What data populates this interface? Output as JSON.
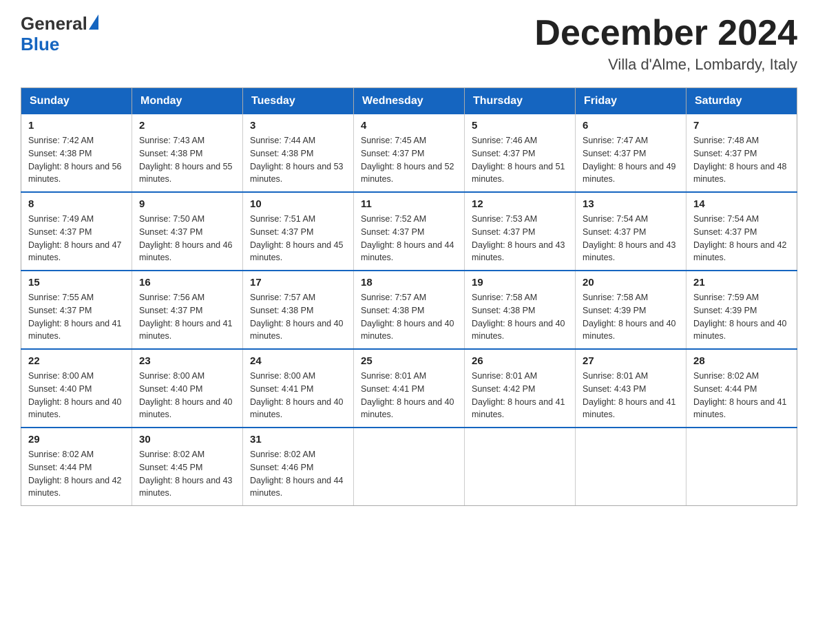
{
  "logo": {
    "general": "General",
    "blue": "Blue"
  },
  "title": "December 2024",
  "subtitle": "Villa d'Alme, Lombardy, Italy",
  "days_header": [
    "Sunday",
    "Monday",
    "Tuesday",
    "Wednesday",
    "Thursday",
    "Friday",
    "Saturday"
  ],
  "weeks": [
    [
      {
        "day": "1",
        "sunrise": "7:42 AM",
        "sunset": "4:38 PM",
        "daylight": "8 hours and 56 minutes."
      },
      {
        "day": "2",
        "sunrise": "7:43 AM",
        "sunset": "4:38 PM",
        "daylight": "8 hours and 55 minutes."
      },
      {
        "day": "3",
        "sunrise": "7:44 AM",
        "sunset": "4:38 PM",
        "daylight": "8 hours and 53 minutes."
      },
      {
        "day": "4",
        "sunrise": "7:45 AM",
        "sunset": "4:37 PM",
        "daylight": "8 hours and 52 minutes."
      },
      {
        "day": "5",
        "sunrise": "7:46 AM",
        "sunset": "4:37 PM",
        "daylight": "8 hours and 51 minutes."
      },
      {
        "day": "6",
        "sunrise": "7:47 AM",
        "sunset": "4:37 PM",
        "daylight": "8 hours and 49 minutes."
      },
      {
        "day": "7",
        "sunrise": "7:48 AM",
        "sunset": "4:37 PM",
        "daylight": "8 hours and 48 minutes."
      }
    ],
    [
      {
        "day": "8",
        "sunrise": "7:49 AM",
        "sunset": "4:37 PM",
        "daylight": "8 hours and 47 minutes."
      },
      {
        "day": "9",
        "sunrise": "7:50 AM",
        "sunset": "4:37 PM",
        "daylight": "8 hours and 46 minutes."
      },
      {
        "day": "10",
        "sunrise": "7:51 AM",
        "sunset": "4:37 PM",
        "daylight": "8 hours and 45 minutes."
      },
      {
        "day": "11",
        "sunrise": "7:52 AM",
        "sunset": "4:37 PM",
        "daylight": "8 hours and 44 minutes."
      },
      {
        "day": "12",
        "sunrise": "7:53 AM",
        "sunset": "4:37 PM",
        "daylight": "8 hours and 43 minutes."
      },
      {
        "day": "13",
        "sunrise": "7:54 AM",
        "sunset": "4:37 PM",
        "daylight": "8 hours and 43 minutes."
      },
      {
        "day": "14",
        "sunrise": "7:54 AM",
        "sunset": "4:37 PM",
        "daylight": "8 hours and 42 minutes."
      }
    ],
    [
      {
        "day": "15",
        "sunrise": "7:55 AM",
        "sunset": "4:37 PM",
        "daylight": "8 hours and 41 minutes."
      },
      {
        "day": "16",
        "sunrise": "7:56 AM",
        "sunset": "4:37 PM",
        "daylight": "8 hours and 41 minutes."
      },
      {
        "day": "17",
        "sunrise": "7:57 AM",
        "sunset": "4:38 PM",
        "daylight": "8 hours and 40 minutes."
      },
      {
        "day": "18",
        "sunrise": "7:57 AM",
        "sunset": "4:38 PM",
        "daylight": "8 hours and 40 minutes."
      },
      {
        "day": "19",
        "sunrise": "7:58 AM",
        "sunset": "4:38 PM",
        "daylight": "8 hours and 40 minutes."
      },
      {
        "day": "20",
        "sunrise": "7:58 AM",
        "sunset": "4:39 PM",
        "daylight": "8 hours and 40 minutes."
      },
      {
        "day": "21",
        "sunrise": "7:59 AM",
        "sunset": "4:39 PM",
        "daylight": "8 hours and 40 minutes."
      }
    ],
    [
      {
        "day": "22",
        "sunrise": "8:00 AM",
        "sunset": "4:40 PM",
        "daylight": "8 hours and 40 minutes."
      },
      {
        "day": "23",
        "sunrise": "8:00 AM",
        "sunset": "4:40 PM",
        "daylight": "8 hours and 40 minutes."
      },
      {
        "day": "24",
        "sunrise": "8:00 AM",
        "sunset": "4:41 PM",
        "daylight": "8 hours and 40 minutes."
      },
      {
        "day": "25",
        "sunrise": "8:01 AM",
        "sunset": "4:41 PM",
        "daylight": "8 hours and 40 minutes."
      },
      {
        "day": "26",
        "sunrise": "8:01 AM",
        "sunset": "4:42 PM",
        "daylight": "8 hours and 41 minutes."
      },
      {
        "day": "27",
        "sunrise": "8:01 AM",
        "sunset": "4:43 PM",
        "daylight": "8 hours and 41 minutes."
      },
      {
        "day": "28",
        "sunrise": "8:02 AM",
        "sunset": "4:44 PM",
        "daylight": "8 hours and 41 minutes."
      }
    ],
    [
      {
        "day": "29",
        "sunrise": "8:02 AM",
        "sunset": "4:44 PM",
        "daylight": "8 hours and 42 minutes."
      },
      {
        "day": "30",
        "sunrise": "8:02 AM",
        "sunset": "4:45 PM",
        "daylight": "8 hours and 43 minutes."
      },
      {
        "day": "31",
        "sunrise": "8:02 AM",
        "sunset": "4:46 PM",
        "daylight": "8 hours and 44 minutes."
      },
      null,
      null,
      null,
      null
    ]
  ]
}
